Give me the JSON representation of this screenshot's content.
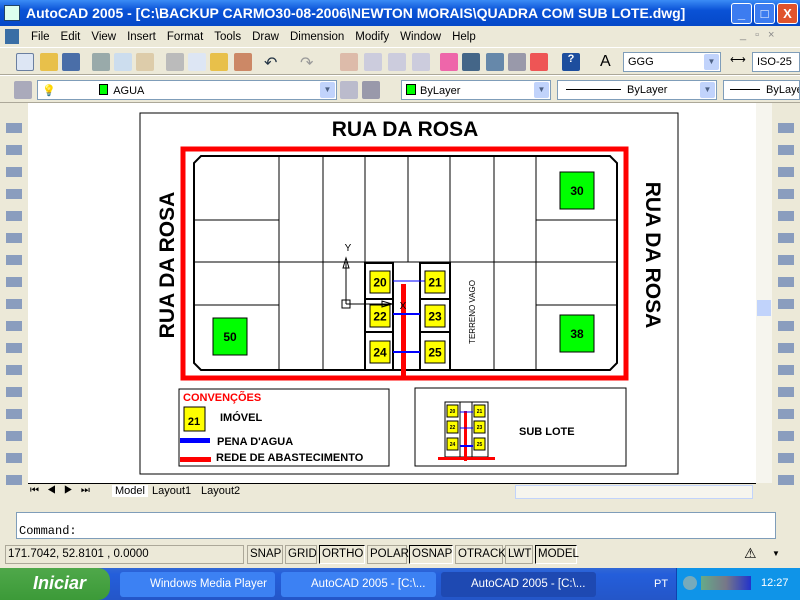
{
  "window": {
    "title": "AutoCAD 2005 - [C:\\BACKUP CARMO30-08-2006\\NEWTON MORAIS\\QUADRA COM SUB LOTE.dwg]",
    "min": "_",
    "max": "□",
    "close": "X"
  },
  "menu": [
    "File",
    "Edit",
    "View",
    "Insert",
    "Format",
    "Tools",
    "Draw",
    "Dimension",
    "Modify",
    "Window",
    "Help"
  ],
  "toolbar": {
    "text_style": "GGG",
    "dim_style": "ISO-25",
    "layer": "AGUA",
    "color": "ByLayer",
    "linetype": "ByLayer",
    "lineweight": "ByLayer"
  },
  "colors": {
    "accent_red": "#ff0000",
    "water_blue": "#0000ff",
    "lot_yellow": "#ffff00",
    "lot_green": "#00ff00"
  },
  "drawing": {
    "street_top": "RUA DA ROSA",
    "street_left": "RUA DA ROSA",
    "street_right": "RUA DA ROSA",
    "vacant": "TERRENO VAGO",
    "lots_yellow": [
      "20",
      "21",
      "22",
      "23",
      "24",
      "25"
    ],
    "lots_green": [
      "30",
      "38",
      "50"
    ],
    "ucs_x": "X",
    "ucs_y": "Y",
    "legend": {
      "title": "CONVENÇÕES",
      "sample": "21",
      "imovel": "IMÓVEL",
      "pena": "PENA D'AGUA",
      "rede": "REDE DE ABASTECIMENTO"
    },
    "sublote": {
      "label": "SUB LOTE",
      "lots": [
        "20",
        "21",
        "22",
        "23",
        "24",
        "25"
      ]
    }
  },
  "tabs": [
    "Model",
    "Layout1",
    "Layout2"
  ],
  "command": {
    "prompt": "Command:"
  },
  "status": {
    "coords": "171.7042, 52.8101  , 0.0000",
    "buttons": [
      {
        "label": "SNAP",
        "on": false
      },
      {
        "label": "GRID",
        "on": false
      },
      {
        "label": "ORTHO",
        "on": true
      },
      {
        "label": "POLAR",
        "on": false
      },
      {
        "label": "OSNAP",
        "on": true
      },
      {
        "label": "OTRACK",
        "on": false
      },
      {
        "label": "LWT",
        "on": false
      },
      {
        "label": "MODEL",
        "on": true
      }
    ]
  },
  "taskbar": {
    "start": "Iniciar",
    "tasks": [
      "Windows Media Player",
      "AutoCAD 2005 - [C:\\...",
      "AutoCAD 2005 - [C:\\..."
    ],
    "lang": "PT",
    "clock": "12:27"
  }
}
